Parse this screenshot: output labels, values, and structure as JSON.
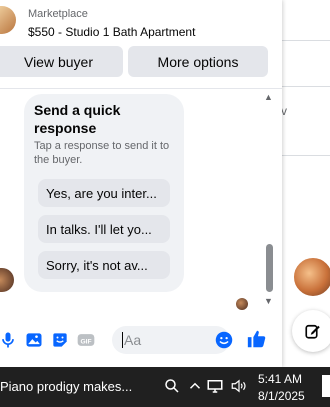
{
  "listing": {
    "category": "Marketplace",
    "title": "$550 - Studio 1 Bath Apartment"
  },
  "header_buttons": {
    "view_buyer": "View buyer",
    "more_options": "More options"
  },
  "quick_response": {
    "title": "Send a quick response",
    "subtitle": "Tap a response to send it to the buyer.",
    "options": [
      "Yes, are you inter...",
      "In talks. I'll let yo...",
      "Sorry, it's not av..."
    ]
  },
  "composer": {
    "placeholder": "Aa",
    "icons": [
      "microphone-icon",
      "photo-icon",
      "sticker-icon",
      "gif-icon",
      "emoji-icon",
      "thumbs-up-icon"
    ],
    "accent": "#0866ff"
  },
  "background": {
    "fragment_text": "v"
  },
  "taskbar": {
    "news": "Piano prodigy makes...",
    "time": "5:41 AM",
    "date": "8/1/2025",
    "tray_icons": [
      "search-icon",
      "chevron-up-icon",
      "cloud-icon",
      "display-icon",
      "volume-icon"
    ]
  }
}
